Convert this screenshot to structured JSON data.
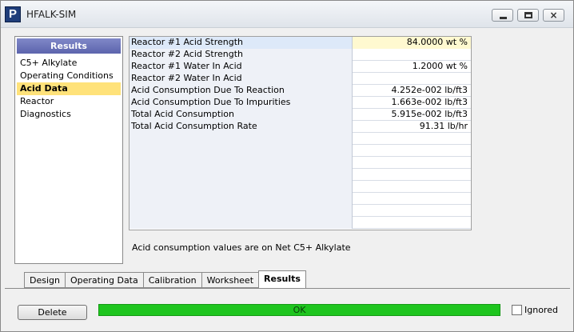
{
  "window": {
    "app_icon_letter": "P",
    "title": "HFALK-SIM",
    "buttons": {
      "minimize": "minimize",
      "maximize": "maximize",
      "close": "×"
    }
  },
  "sidebar": {
    "header": "Results",
    "items": [
      {
        "label": "C5+ Alkylate",
        "selected": false
      },
      {
        "label": "Operating Conditions",
        "selected": false
      },
      {
        "label": "Acid Data",
        "selected": true
      },
      {
        "label": "Reactor",
        "selected": false
      },
      {
        "label": "Diagnostics",
        "selected": false
      }
    ]
  },
  "grid": {
    "rows": [
      {
        "label": "Reactor #1 Acid Strength",
        "value": "84.0000 wt %"
      },
      {
        "label": "Reactor #2 Acid Strength",
        "value": ""
      },
      {
        "label": "Reactor #1 Water In Acid",
        "value": "1.2000 wt %"
      },
      {
        "label": "Reactor #2 Water In Acid",
        "value": ""
      },
      {
        "label": "Acid Consumption Due To Reaction",
        "value": "4.252e-002 lb/ft3"
      },
      {
        "label": "Acid Consumption Due To Impurities",
        "value": "1.663e-002 lb/ft3"
      },
      {
        "label": "Total Acid Consumption",
        "value": "5.915e-002 lb/ft3"
      },
      {
        "label": "Total Acid Consumption Rate",
        "value": "91.31 lb/hr"
      },
      {
        "label": "",
        "value": ""
      },
      {
        "label": "",
        "value": ""
      },
      {
        "label": "",
        "value": ""
      },
      {
        "label": "",
        "value": ""
      },
      {
        "label": "",
        "value": ""
      },
      {
        "label": "",
        "value": ""
      },
      {
        "label": "",
        "value": ""
      },
      {
        "label": "",
        "value": ""
      }
    ]
  },
  "note": "Acid consumption values are on Net C5+ Alkylate",
  "tabs": [
    {
      "label": "Design",
      "active": false
    },
    {
      "label": "Operating Data",
      "active": false
    },
    {
      "label": "Calibration",
      "active": false
    },
    {
      "label": "Worksheet",
      "active": false
    },
    {
      "label": "Results",
      "active": true
    }
  ],
  "footer": {
    "delete_label": "Delete",
    "status_text": "OK",
    "status_color": "#1ec51e",
    "ignored_label": "Ignored",
    "ignored_checked": false
  }
}
